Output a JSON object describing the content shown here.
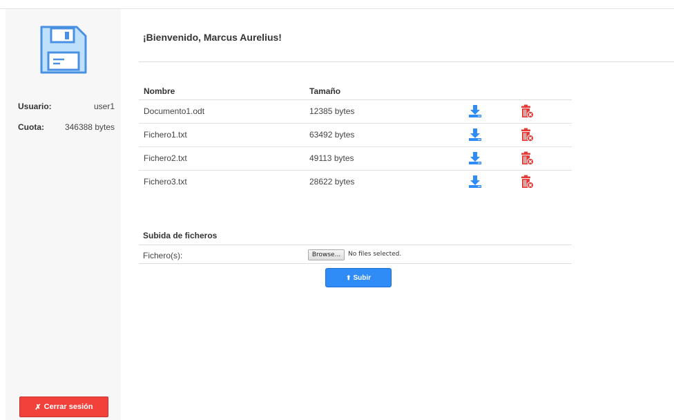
{
  "sidebar": {
    "user_label": "Usuario:",
    "user_value": "user1",
    "quota_label": "Cuota:",
    "quota_value": "346388 bytes",
    "logout_icon": "✗",
    "logout_label": "Cerrar sesión"
  },
  "main": {
    "welcome": "¡Bienvenido, Marcus Aurelius!",
    "table": {
      "headers": [
        "Nombre",
        "Tamaño"
      ],
      "rows": [
        {
          "name": "Documento1.odt",
          "size": "12385 bytes"
        },
        {
          "name": "Fichero1.txt",
          "size": "63492 bytes"
        },
        {
          "name": "Fichero2.txt",
          "size": "49113 bytes"
        },
        {
          "name": "Fichero3.txt",
          "size": "28622 bytes"
        }
      ]
    },
    "upload": {
      "title": "Subida de ficheros",
      "field_label": "Fichero(s):",
      "browse_label": "Browse...",
      "no_file_text": "No files selected.",
      "submit_icon": "⬆",
      "submit_label": "Subir"
    }
  },
  "colors": {
    "accent_blue": "#2f8cf7",
    "danger_red": "#f2413b",
    "logo_blue": "#4a90e2"
  },
  "icons": {
    "logo": "floppy-disk-icon",
    "download": "download-icon",
    "delete": "trash-delete-icon"
  }
}
